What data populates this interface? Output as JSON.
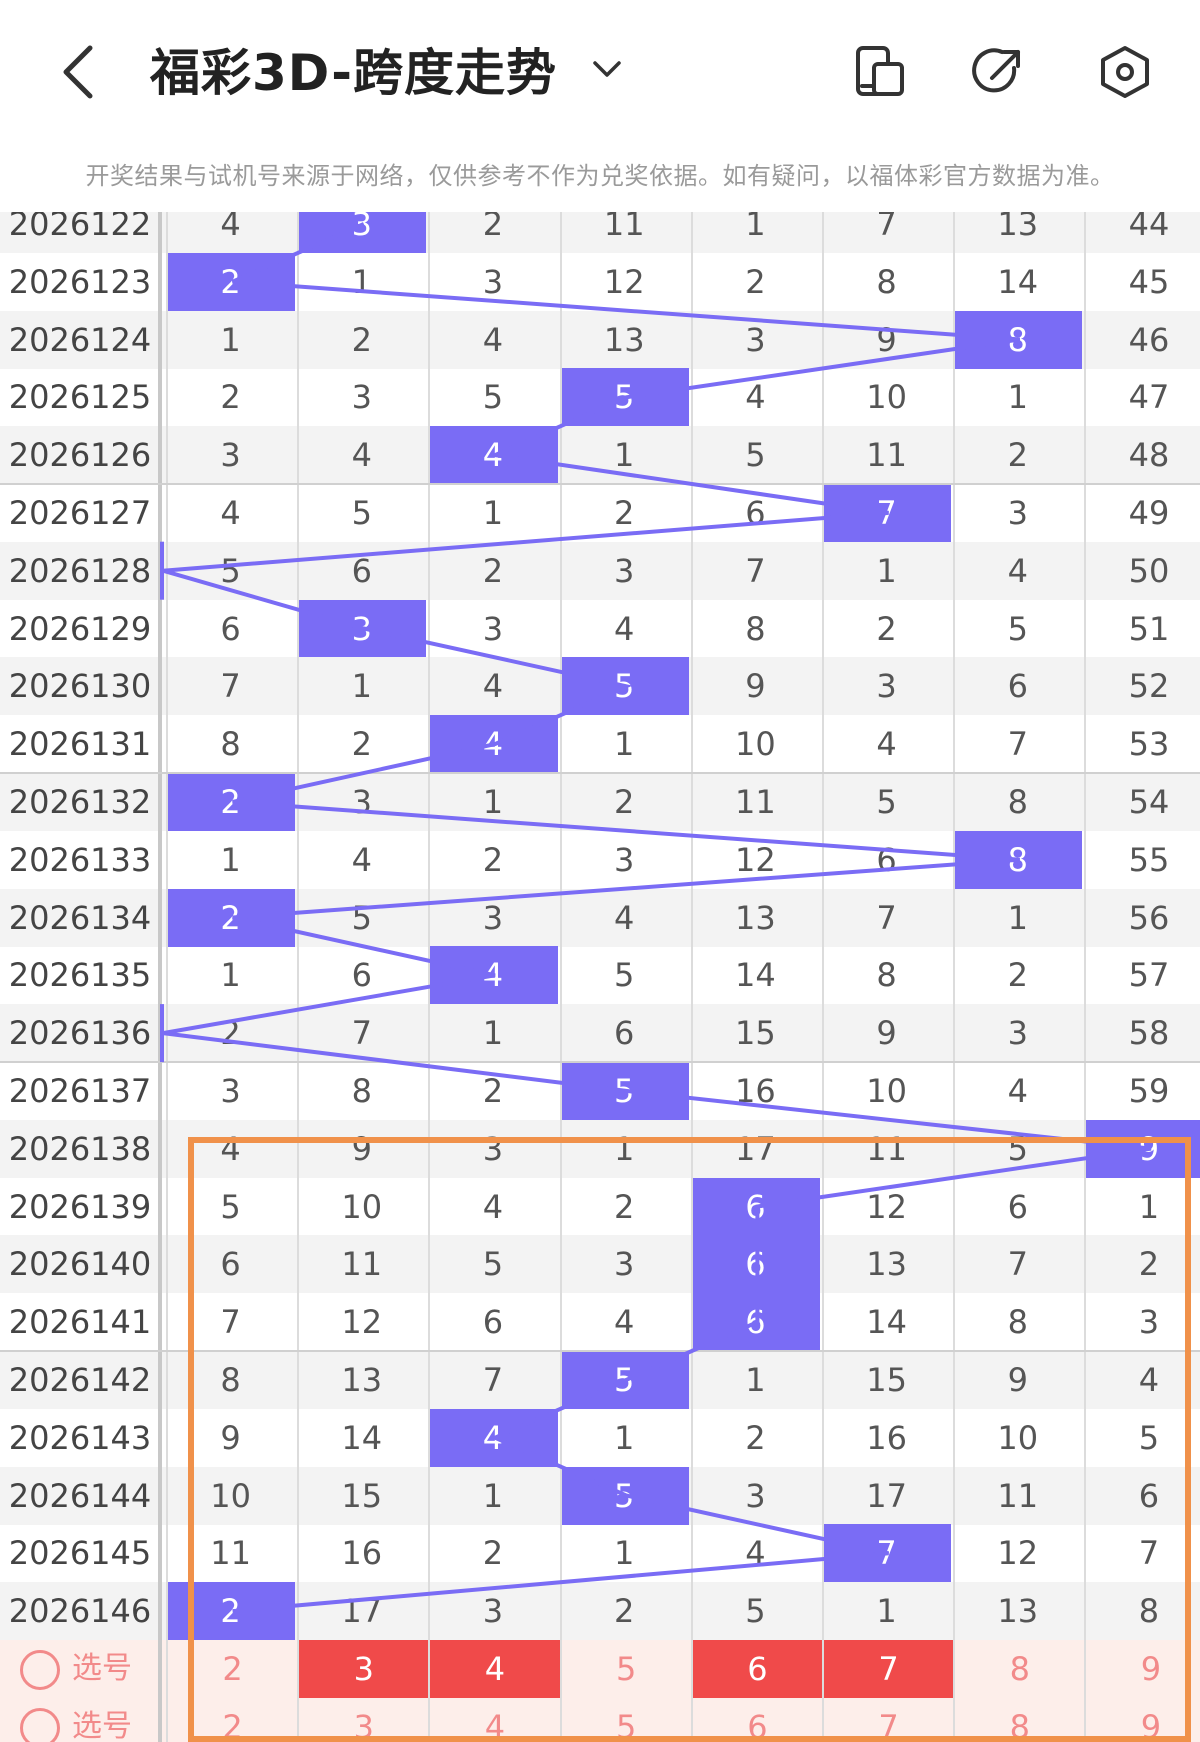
{
  "header": {
    "title": "福彩3D-跨度走势",
    "back_icon": "back-arrow-icon",
    "dropdown_icon": "chevron-down-icon",
    "icons": [
      "device-icon",
      "share-icon",
      "settings-hex-icon"
    ]
  },
  "notice": "开奖结果与试机号来源于网络，仅供参考不作为兑奖依据。如有疑问，以福体彩官方数据为准。",
  "colors": {
    "hit": "#7a6cf5",
    "pick_red": "#f04a4a",
    "pick_pink": "#f28a8a",
    "highlight": "#f0914a"
  },
  "rows": [
    {
      "issue": "2026122",
      "cells": [
        "4",
        "3",
        "2",
        "11",
        "1",
        "7",
        "13",
        "44"
      ],
      "hit": 1
    },
    {
      "issue": "2026123",
      "cells": [
        "2",
        "1",
        "3",
        "12",
        "2",
        "8",
        "14",
        "45"
      ],
      "hit": 0
    },
    {
      "issue": "2026124",
      "cells": [
        "1",
        "2",
        "4",
        "13",
        "3",
        "9",
        "8",
        "46"
      ],
      "hit": 6
    },
    {
      "issue": "2026125",
      "cells": [
        "2",
        "3",
        "5",
        "5",
        "4",
        "10",
        "1",
        "47"
      ],
      "hit": 3
    },
    {
      "issue": "2026126",
      "cells": [
        "3",
        "4",
        "4",
        "1",
        "5",
        "11",
        "2",
        "48"
      ],
      "hit": 2
    },
    {
      "issue": "2026127",
      "cells": [
        "4",
        "5",
        "1",
        "2",
        "6",
        "7",
        "3",
        "49"
      ],
      "hit": 5
    },
    {
      "issue": "2026128",
      "cells": [
        "5",
        "6",
        "2",
        "3",
        "7",
        "1",
        "4",
        "50"
      ],
      "hit": -1
    },
    {
      "issue": "2026129",
      "cells": [
        "6",
        "3",
        "3",
        "4",
        "8",
        "2",
        "5",
        "51"
      ],
      "hit": 1
    },
    {
      "issue": "2026130",
      "cells": [
        "7",
        "1",
        "4",
        "5",
        "9",
        "3",
        "6",
        "52"
      ],
      "hit": 3
    },
    {
      "issue": "2026131",
      "cells": [
        "8",
        "2",
        "4",
        "1",
        "10",
        "4",
        "7",
        "53"
      ],
      "hit": 2
    },
    {
      "issue": "2026132",
      "cells": [
        "2",
        "3",
        "1",
        "2",
        "11",
        "5",
        "8",
        "54"
      ],
      "hit": 0
    },
    {
      "issue": "2026133",
      "cells": [
        "1",
        "4",
        "2",
        "3",
        "12",
        "6",
        "8",
        "55"
      ],
      "hit": 6
    },
    {
      "issue": "2026134",
      "cells": [
        "2",
        "5",
        "3",
        "4",
        "13",
        "7",
        "1",
        "56"
      ],
      "hit": 0
    },
    {
      "issue": "2026135",
      "cells": [
        "1",
        "6",
        "4",
        "5",
        "14",
        "8",
        "2",
        "57"
      ],
      "hit": 2
    },
    {
      "issue": "2026136",
      "cells": [
        "2",
        "7",
        "1",
        "6",
        "15",
        "9",
        "3",
        "58"
      ],
      "hit": -1
    },
    {
      "issue": "2026137",
      "cells": [
        "3",
        "8",
        "2",
        "5",
        "16",
        "10",
        "4",
        "59"
      ],
      "hit": 3
    },
    {
      "issue": "2026138",
      "cells": [
        "4",
        "9",
        "3",
        "1",
        "17",
        "11",
        "5",
        "9"
      ],
      "hit": 7
    },
    {
      "issue": "2026139",
      "cells": [
        "5",
        "10",
        "4",
        "2",
        "6",
        "12",
        "6",
        "1"
      ],
      "hit": 4
    },
    {
      "issue": "2026140",
      "cells": [
        "6",
        "11",
        "5",
        "3",
        "6",
        "13",
        "7",
        "2"
      ],
      "hit": 4
    },
    {
      "issue": "2026141",
      "cells": [
        "7",
        "12",
        "6",
        "4",
        "6",
        "14",
        "8",
        "3"
      ],
      "hit": 4
    },
    {
      "issue": "2026142",
      "cells": [
        "8",
        "13",
        "7",
        "5",
        "1",
        "15",
        "9",
        "4"
      ],
      "hit": 3
    },
    {
      "issue": "2026143",
      "cells": [
        "9",
        "14",
        "4",
        "1",
        "2",
        "16",
        "10",
        "5"
      ],
      "hit": 2
    },
    {
      "issue": "2026144",
      "cells": [
        "10",
        "15",
        "1",
        "5",
        "3",
        "17",
        "11",
        "6"
      ],
      "hit": 3
    },
    {
      "issue": "2026145",
      "cells": [
        "11",
        "16",
        "2",
        "1",
        "4",
        "7",
        "12",
        "7"
      ],
      "hit": 5
    },
    {
      "issue": "2026146",
      "cells": [
        "2",
        "17",
        "3",
        "2",
        "5",
        "1",
        "13",
        "8"
      ],
      "hit": 0
    }
  ],
  "pick_rows": [
    {
      "label": "选号",
      "cells": [
        "2",
        "3",
        "4",
        "5",
        "6",
        "7",
        "8",
        "9"
      ],
      "red": [
        1,
        2,
        4,
        5
      ]
    },
    {
      "label": "选号",
      "cells": [
        "2",
        "3",
        "4",
        "5",
        "6",
        "7",
        "8",
        "9"
      ],
      "red": []
    }
  ]
}
